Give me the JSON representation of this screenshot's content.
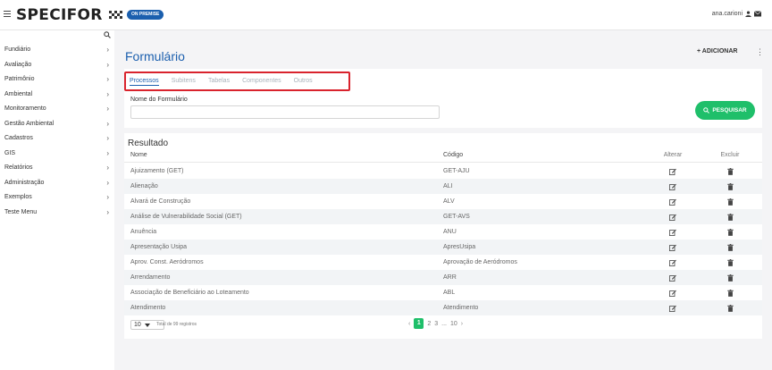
{
  "header": {
    "logo": "SPECIFOR",
    "badge": "ON PREMISE",
    "user": "ana.carioni"
  },
  "sidebar": {
    "items": [
      {
        "label": "Fundiário"
      },
      {
        "label": "Avaliação"
      },
      {
        "label": "Patrimônio"
      },
      {
        "label": "Ambiental"
      },
      {
        "label": "Monitoramento"
      },
      {
        "label": "Gestão Ambiental"
      },
      {
        "label": "Cadastros"
      },
      {
        "label": "GIS"
      },
      {
        "label": "Relatórios"
      },
      {
        "label": "Administração"
      },
      {
        "label": "Exemplos"
      },
      {
        "label": "Teste Menu"
      }
    ]
  },
  "page": {
    "title": "Formulário",
    "add_label": "+ ADICIONAR"
  },
  "tabs": [
    "Processos",
    "Subitens",
    "Tabelas",
    "Componentes",
    "Outros"
  ],
  "filter": {
    "label": "Nome do Formulário",
    "value": "",
    "search_label": "PESQUISAR"
  },
  "results": {
    "title": "Resultado",
    "columns": [
      "Nome",
      "Código",
      "Alterar",
      "Excluir"
    ],
    "rows": [
      {
        "nome": "Ajuizamento (GET)",
        "codigo": "GET-AJU"
      },
      {
        "nome": "Alienação",
        "codigo": "ALI"
      },
      {
        "nome": "Alvará de Construção",
        "codigo": "ALV"
      },
      {
        "nome": "Análise de Vulnerabilidade Social (GET)",
        "codigo": "GET-AVS"
      },
      {
        "nome": "Anuência",
        "codigo": "ANU"
      },
      {
        "nome": "Apresentação Usipa",
        "codigo": "ApresUsipa"
      },
      {
        "nome": "Aprov. Const. Aeródromos",
        "codigo": "Aprovação de Aeródromos"
      },
      {
        "nome": "Arrendamento",
        "codigo": "ARR"
      },
      {
        "nome": "Associação de Beneficiário ao Loteamento",
        "codigo": "ABL"
      },
      {
        "nome": "Atendimento",
        "codigo": "Atendimento"
      }
    ]
  },
  "pagination": {
    "page_size": "10",
    "total": "Total de 99 registros",
    "prev": "‹",
    "pages": [
      "1",
      "2",
      "3",
      "...",
      "10"
    ],
    "next": "›"
  },
  "colors": {
    "brand_blue": "#1b5fae",
    "accent_green": "#1fbf6a",
    "highlight_red": "#d9232d"
  }
}
